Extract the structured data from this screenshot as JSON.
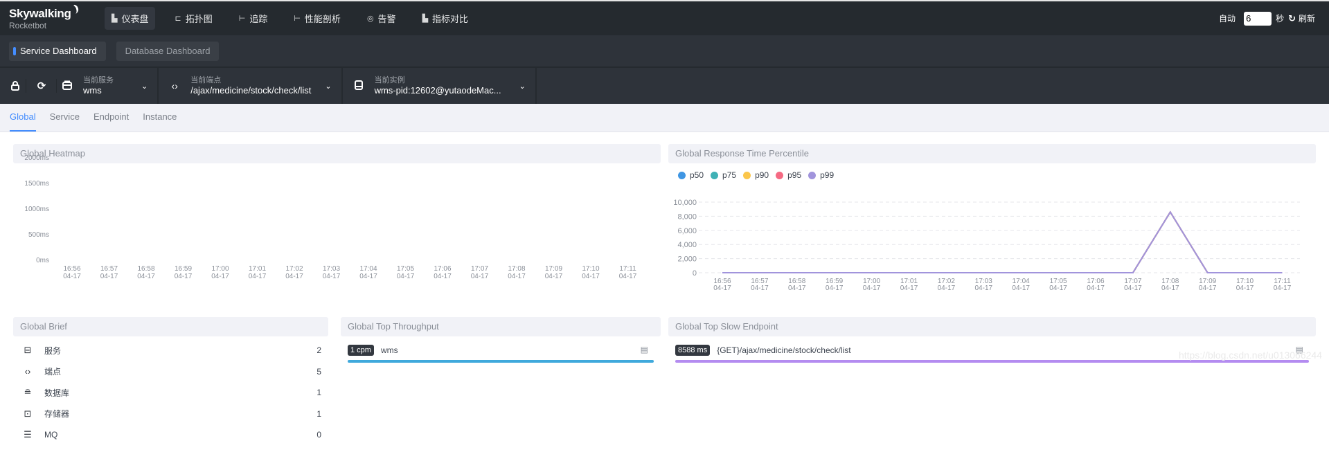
{
  "app": {
    "logo_main": "Skywalking",
    "logo_sub": "Rocketbot"
  },
  "topnav": {
    "items": [
      {
        "label": "仪表盘",
        "icon": "chart-icon",
        "glyph": "▙",
        "active": true
      },
      {
        "label": "拓扑图",
        "icon": "topology-icon",
        "glyph": "⊏",
        "active": false
      },
      {
        "label": "追踪",
        "icon": "trace-icon",
        "glyph": "⊢",
        "active": false
      },
      {
        "label": "性能剖析",
        "icon": "profile-icon",
        "glyph": "⊢",
        "active": false
      },
      {
        "label": "告警",
        "icon": "alarm-icon",
        "glyph": "◎",
        "active": false
      },
      {
        "label": "指标对比",
        "icon": "compare-icon",
        "glyph": "▙",
        "active": false
      }
    ],
    "auto_label": "自动",
    "auto_value": "6",
    "seconds_label": "秒",
    "refresh_label": "刷新"
  },
  "dashboards": [
    {
      "label": "Service Dashboard",
      "active": true
    },
    {
      "label": "Database Dashboard",
      "active": false
    }
  ],
  "selectors": {
    "service": {
      "label": "当前服务",
      "value": "wms"
    },
    "endpoint": {
      "label": "当前端点",
      "value": "/ajax/medicine/stock/check/list"
    },
    "instance": {
      "label": "当前实例",
      "value": "wms-pid:12602@yutaodeMac..."
    }
  },
  "tabs": [
    {
      "label": "Global",
      "active": true
    },
    {
      "label": "Service",
      "active": false
    },
    {
      "label": "Endpoint",
      "active": false
    },
    {
      "label": "Instance",
      "active": false
    }
  ],
  "heatmap": {
    "title": "Global Heatmap"
  },
  "percentile": {
    "title": "Global Response Time Percentile"
  },
  "brief": {
    "title": "Global Brief",
    "items": [
      {
        "label": "服务",
        "value": "2",
        "icon": "service-icon",
        "glyph": "⊟"
      },
      {
        "label": "端点",
        "value": "5",
        "icon": "endpoint-icon",
        "glyph": "‹›"
      },
      {
        "label": "数据库",
        "value": "1",
        "icon": "database-icon",
        "glyph": "≘"
      },
      {
        "label": "存储器",
        "value": "1",
        "icon": "cache-icon",
        "glyph": "⊡"
      },
      {
        "label": "MQ",
        "value": "0",
        "icon": "mq-icon",
        "glyph": "☰"
      }
    ]
  },
  "throughput": {
    "title": "Global Top Throughput",
    "items": [
      {
        "badge": "1 cpm",
        "name": "wms",
        "color": "#3fa9dc"
      }
    ]
  },
  "slow": {
    "title": "Global Top Slow Endpoint",
    "items": [
      {
        "badge": "8588 ms",
        "name": "{GET}/ajax/medicine/stock/check/list",
        "color": "#b48cf0"
      }
    ]
  },
  "watermark": "https://blog.csdn.net/u013066244",
  "chart_data": [
    {
      "type": "heatmap",
      "title": "Global Heatmap",
      "xlabel": "",
      "ylabel": "",
      "x": [
        "16:56\n04-17",
        "16:57\n04-17",
        "16:58\n04-17",
        "16:59\n04-17",
        "17:00\n04-17",
        "17:01\n04-17",
        "17:02\n04-17",
        "17:03\n04-17",
        "17:04\n04-17",
        "17:05\n04-17",
        "17:06\n04-17",
        "17:07\n04-17",
        "17:08\n04-17",
        "17:09\n04-17",
        "17:10\n04-17",
        "17:11\n04-17"
      ],
      "y_ticks": [
        "0ms",
        "500ms",
        "1000ms",
        "1500ms",
        "2000ms"
      ],
      "ylim": [
        0,
        2000
      ],
      "values": []
    },
    {
      "type": "line",
      "title": "Global Response Time Percentile",
      "x": [
        "16:56\n04-17",
        "16:57\n04-17",
        "16:58\n04-17",
        "16:59\n04-17",
        "17:00\n04-17",
        "17:01\n04-17",
        "17:02\n04-17",
        "17:03\n04-17",
        "17:04\n04-17",
        "17:05\n04-17",
        "17:06\n04-17",
        "17:07\n04-17",
        "17:08\n04-17",
        "17:09\n04-17",
        "17:10\n04-17",
        "17:11\n04-17"
      ],
      "y_ticks": [
        "0",
        "2,000",
        "4,000",
        "6,000",
        "8,000",
        "10,000"
      ],
      "ylim": [
        0,
        10000
      ],
      "grid": true,
      "legend": "top-left",
      "series": [
        {
          "name": "p50",
          "color": "#3f96e3",
          "values": [
            0,
            0,
            0,
            0,
            0,
            0,
            0,
            0,
            0,
            0,
            0,
            0,
            8588,
            0,
            0,
            0
          ]
        },
        {
          "name": "p75",
          "color": "#3fb1b5",
          "values": [
            0,
            0,
            0,
            0,
            0,
            0,
            0,
            0,
            0,
            0,
            0,
            0,
            8588,
            0,
            0,
            0
          ]
        },
        {
          "name": "p90",
          "color": "#fbc64b",
          "values": [
            0,
            0,
            0,
            0,
            0,
            0,
            0,
            0,
            0,
            0,
            0,
            0,
            8588,
            0,
            0,
            0
          ]
        },
        {
          "name": "p95",
          "color": "#f56a83",
          "values": [
            0,
            0,
            0,
            0,
            0,
            0,
            0,
            0,
            0,
            0,
            0,
            0,
            8588,
            0,
            0,
            0
          ]
        },
        {
          "name": "p99",
          "color": "#a194dc",
          "values": [
            0,
            0,
            0,
            0,
            0,
            0,
            0,
            0,
            0,
            0,
            0,
            0,
            8588,
            0,
            0,
            0
          ]
        }
      ]
    }
  ]
}
